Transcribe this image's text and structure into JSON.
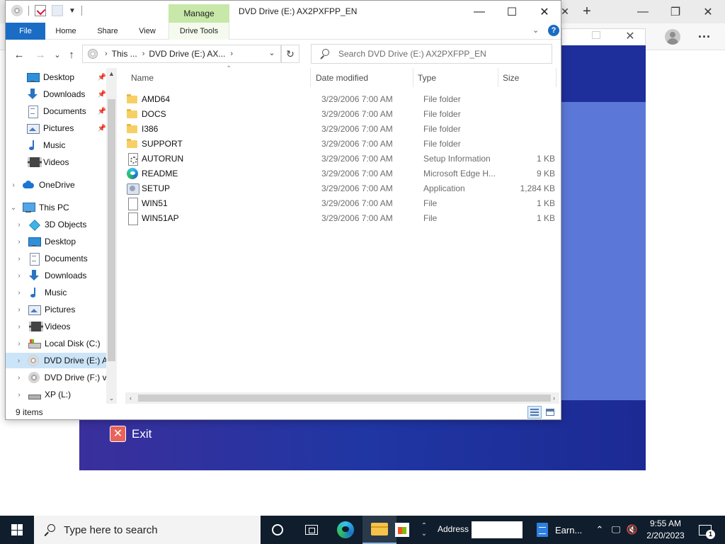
{
  "explorer": {
    "window_title": "DVD Drive (E:) AX2PXFPP_EN",
    "manage_tab": "Manage",
    "ribbon_tabs": [
      "File",
      "Home",
      "Share",
      "View",
      "Drive Tools"
    ],
    "address": {
      "segments": [
        "This ...",
        "DVD Drive (E:) AX..."
      ]
    },
    "search": {
      "placeholder": "Search DVD Drive (E:) AX2PXFPP_EN"
    },
    "columns": {
      "name": "Name",
      "date": "Date modified",
      "type": "Type",
      "size": "Size"
    },
    "quick_access": [
      {
        "label": "Desktop",
        "icon": "desktop-icon",
        "pinned": true
      },
      {
        "label": "Downloads",
        "icon": "downloads-icon",
        "pinned": true
      },
      {
        "label": "Documents",
        "icon": "documents-icon",
        "pinned": true
      },
      {
        "label": "Pictures",
        "icon": "pictures-icon",
        "pinned": true
      },
      {
        "label": "Music",
        "icon": "music-icon",
        "pinned": false
      },
      {
        "label": "Videos",
        "icon": "videos-icon",
        "pinned": false
      }
    ],
    "onedrive": "OneDrive",
    "this_pc": "This PC",
    "pc_children": [
      {
        "label": "3D Objects",
        "icon": "3d-objects-icon"
      },
      {
        "label": "Desktop",
        "icon": "desktop-icon"
      },
      {
        "label": "Documents",
        "icon": "documents-icon"
      },
      {
        "label": "Downloads",
        "icon": "downloads-icon"
      },
      {
        "label": "Music",
        "icon": "music-icon"
      },
      {
        "label": "Pictures",
        "icon": "pictures-icon"
      },
      {
        "label": "Videos",
        "icon": "videos-icon"
      },
      {
        "label": "Local Disk (C:)",
        "icon": "local-disk-icon"
      },
      {
        "label": "DVD Drive (E:) AX",
        "icon": "dvd-drive-icon",
        "selected": true
      },
      {
        "label": "DVD Drive (F:) vi",
        "icon": "cd-drive-icon"
      },
      {
        "label": "XP (L:)",
        "icon": "usb-drive-icon"
      }
    ],
    "files": [
      {
        "name": "AMD64",
        "date": "3/29/2006 7:00 AM",
        "type": "File folder",
        "size": "",
        "icon": "folder-icon"
      },
      {
        "name": "DOCS",
        "date": "3/29/2006 7:00 AM",
        "type": "File folder",
        "size": "",
        "icon": "folder-icon"
      },
      {
        "name": "I386",
        "date": "3/29/2006 7:00 AM",
        "type": "File folder",
        "size": "",
        "icon": "folder-icon"
      },
      {
        "name": "SUPPORT",
        "date": "3/29/2006 7:00 AM",
        "type": "File folder",
        "size": "",
        "icon": "folder-icon"
      },
      {
        "name": "AUTORUN",
        "date": "3/29/2006 7:00 AM",
        "type": "Setup Information",
        "size": "1 KB",
        "icon": "setup-information-icon"
      },
      {
        "name": "README",
        "date": "3/29/2006 7:00 AM",
        "type": "Microsoft Edge H...",
        "size": "9 KB",
        "icon": "edge-icon"
      },
      {
        "name": "SETUP",
        "date": "3/29/2006 7:00 AM",
        "type": "Application",
        "size": "1,284 KB",
        "icon": "application-icon"
      },
      {
        "name": "WIN51",
        "date": "3/29/2006 7:00 AM",
        "type": "File",
        "size": "1 KB",
        "icon": "file-icon"
      },
      {
        "name": "WIN51AP",
        "date": "3/29/2006 7:00 AM",
        "type": "File",
        "size": "1 KB",
        "icon": "file-icon"
      }
    ],
    "status": "9 items"
  },
  "setup_dialog": {
    "exit_label": "Exit",
    "exit_accent": "#e8645a",
    "panel_color": "#1f2a8a"
  },
  "taskbar": {
    "search_placeholder": "Type here to search",
    "address_label": "Address",
    "address_value": "",
    "doc_window_label": "Earn...",
    "time": "9:55 AM",
    "date": "2/20/2023",
    "notification_count": "1"
  },
  "colors": {
    "accent": "#1a6cc4",
    "manage_tab": "#c7e8a8",
    "selection": "#cce4f7",
    "taskbar": "#0f1d2c"
  }
}
